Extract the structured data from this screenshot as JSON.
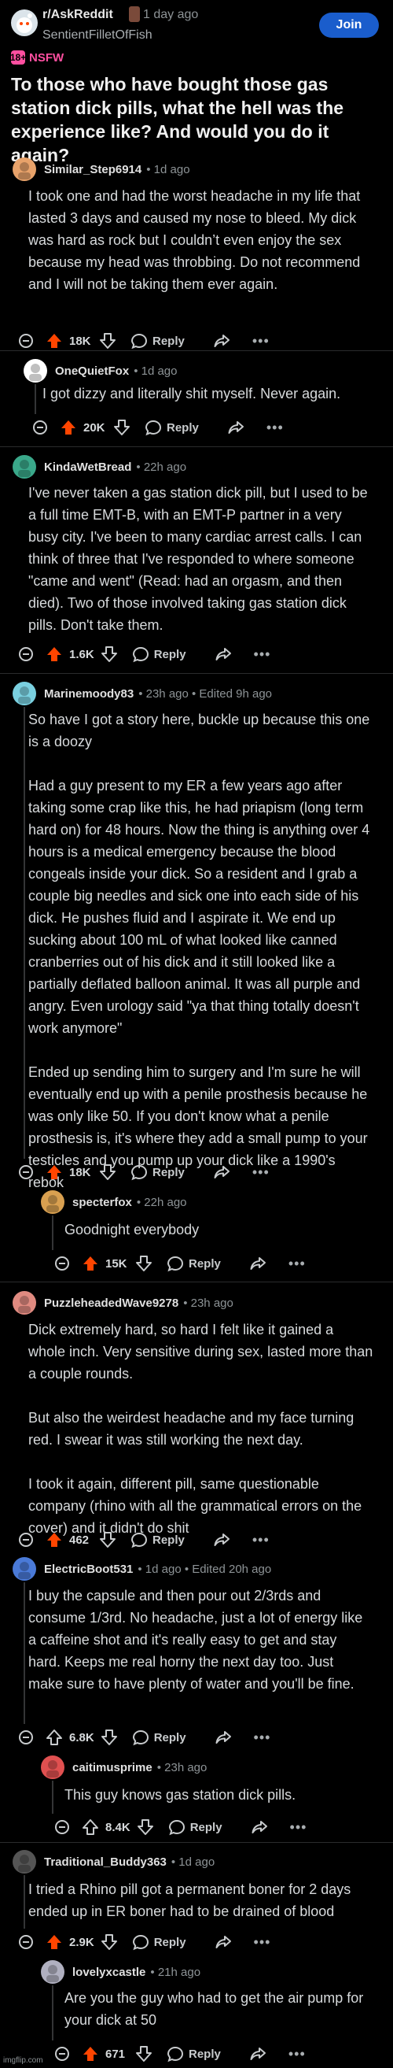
{
  "header": {
    "subreddit": "r/AskReddit",
    "time": "1 day ago",
    "username": "SentientFilletOfFish",
    "join_label": "Join",
    "nsfw_label": "NSFW",
    "nsfw_icon": "18+"
  },
  "post": {
    "title": "To those who have bought those gas station dick pills, what the hell was the experience like? And would you do it again?"
  },
  "reply_label": "Reply",
  "comments": [
    {
      "user": "Similar_Step6914",
      "meta": "• 1d ago",
      "avatar_color": "#e8a26a",
      "paragraphs": [
        "I took one and had the worst headache in my life that lasted 3 days and caused my nose to bleed. My dick was hard as rock but I couldn’t even enjoy the sex because my head was throbbing. Do not recommend and I will not be taking them ever again."
      ],
      "score": "18K",
      "upvoted": true
    },
    {
      "user": "OneQuietFox",
      "meta": "• 1d ago",
      "avatar_color": "#ffffff",
      "paragraphs": [
        "I got dizzy and literally shit myself. Never again."
      ],
      "score": "20K",
      "upvoted": true
    },
    {
      "user": "KindaWetBread",
      "meta": "• 22h ago",
      "avatar_color": "#3aa88a",
      "paragraphs": [
        "I've never taken a gas station dick pill, but I used to be a full time EMT-B, with an EMT-P partner in a very busy city. I've been to many cardiac arrest calls. I can think of three that I've responded to where someone \"came and went\" (Read: had an orgasm, and then died). Two of those involved taking gas station dick pills. Don't take them."
      ],
      "score": "1.6K",
      "upvoted": true
    },
    {
      "user": "Marinemoody83",
      "meta": "• 23h ago • Edited 9h ago",
      "avatar_color": "#7ad0e0",
      "paragraphs": [
        "So have I got a story here, buckle up because this one is a doozy",
        "Had a guy present to my ER a few years ago after taking some crap like this, he had priapism (long term hard on) for 48 hours. Now the thing is anything over 4 hours is a medical emergency because the blood congeals inside your dick. So a resident and I grab a couple big needles and sick one into each side of his dick. He pushes fluid and I aspirate it. We end up sucking about 100 mL of what looked like canned cranberries out of his dick and it still looked like a partially deflated balloon animal. It was all purple and angry. Even urology said \"ya that thing totally doesn't work anymore\"",
        "Ended up sending him to surgery and I'm sure he will eventually end up with a penile prosthesis because he was only like 50. If you don't know what a penile prosthesis is, it's where they add a small pump to your testicles and you pump up your dick like a 1990's rebok"
      ],
      "score": "18K",
      "upvoted": true
    },
    {
      "user": "specterfox",
      "meta": "• 22h ago",
      "avatar_color": "#d9a050",
      "paragraphs": [
        "Goodnight everybody"
      ],
      "score": "15K",
      "upvoted": true
    },
    {
      "user": "PuzzleheadedWave9278",
      "meta": "• 23h ago",
      "avatar_color": "#e08a80",
      "paragraphs": [
        "Dick extremely hard, so hard I felt like it gained a whole inch. Very sensitive during sex, lasted more than a couple rounds.",
        "But also the weirdest headache and my face turning red. I swear it was still working the next day.",
        "I took it again, different pill, same questionable company (rhino with all the grammatical errors on the cover) and it didn't do shit"
      ],
      "score": "462",
      "upvoted": true
    },
    {
      "user": "ElectricBoot531",
      "meta": "• 1d ago • Edited 20h ago",
      "avatar_color": "#4a7ad8",
      "paragraphs": [
        "I buy the capsule and then pour out 2/3rds and consume 1/3rd. No headache, just a lot of energy like a caffeine shot and it's really easy to get and stay hard. Keeps me real horny the next day too. Just make sure to have plenty of water and you'll be fine."
      ],
      "score": "6.8K",
      "upvoted": false
    },
    {
      "user": "caitimusprime",
      "meta": "• 23h ago",
      "avatar_color": "#e05050",
      "paragraphs": [
        "This guy knows gas station dick pills."
      ],
      "score": "8.4K",
      "upvoted": false
    },
    {
      "user": "Traditional_Buddy363",
      "meta": "• 1d ago",
      "avatar_color": "#555555",
      "paragraphs": [
        "I tried a Rhino pill got a permanent boner for 2 days ended up in ER boner had to be drained of blood"
      ],
      "score": "2.9K",
      "upvoted": true
    },
    {
      "user": "lovelyxcastle",
      "meta": "• 21h ago",
      "avatar_color": "#b0b0c0",
      "paragraphs": [
        "Are you the guy who had to get the air pump for your dick at 50"
      ],
      "score": "671",
      "upvoted": true
    }
  ],
  "watermark": "imgflip.com",
  "colors": {
    "upvote": "#ff4500",
    "join": "#1a5dcc",
    "nsfw": "#ff4fa0"
  }
}
